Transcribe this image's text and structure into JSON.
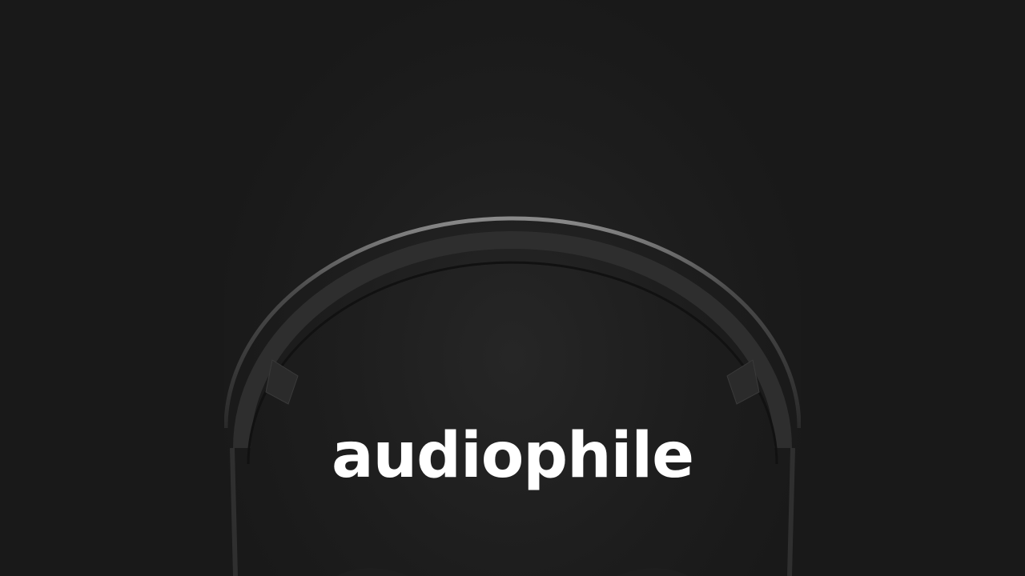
{
  "brand": {
    "wordmark": "audiophile"
  },
  "hero": {
    "image": "headphones-icon"
  },
  "colors": {
    "background": "#191919",
    "panel": "#262626",
    "wordmark": "#ffffff"
  }
}
